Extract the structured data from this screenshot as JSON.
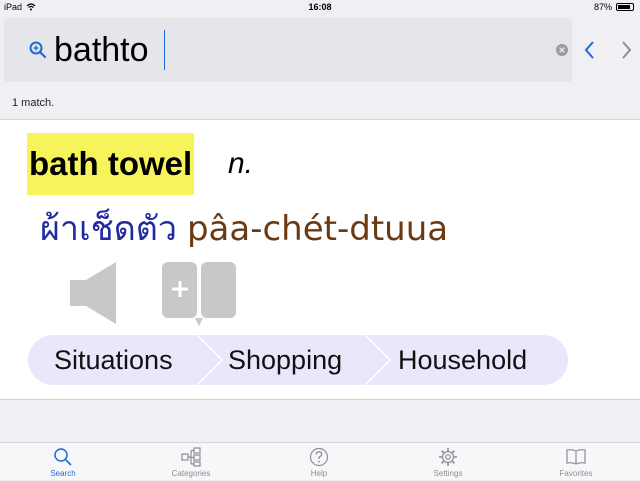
{
  "status": {
    "device": "iPad",
    "time": "16:08",
    "battery": "87%",
    "battery_level": 0.87
  },
  "search": {
    "value": "bathto",
    "placeholder": ""
  },
  "results": {
    "match_count": "1 match."
  },
  "entry": {
    "headword": "bath towel",
    "pos": "n.",
    "thai": "ผ้าเช็ดตัว",
    "transliteration": "pâa-chét-dtuua",
    "breadcrumb": [
      "Situations",
      "Shopping",
      "Household"
    ]
  },
  "tabs": [
    {
      "label": "Search",
      "icon": "search-icon",
      "active": true
    },
    {
      "label": "Categories",
      "icon": "categories-icon",
      "active": false
    },
    {
      "label": "Help",
      "icon": "help-icon",
      "active": false
    },
    {
      "label": "Settings",
      "icon": "gear-icon",
      "active": false
    },
    {
      "label": "Favorites",
      "icon": "book-icon",
      "active": false
    }
  ],
  "colors": {
    "accent": "#1a6bd8",
    "highlight": "#f6f45a",
    "thai_text": "#1f2b9e",
    "transliteration_text": "#6b3a12",
    "breadcrumb_bg": "#ece6fb",
    "icon_gray": "#c8c8c8"
  }
}
